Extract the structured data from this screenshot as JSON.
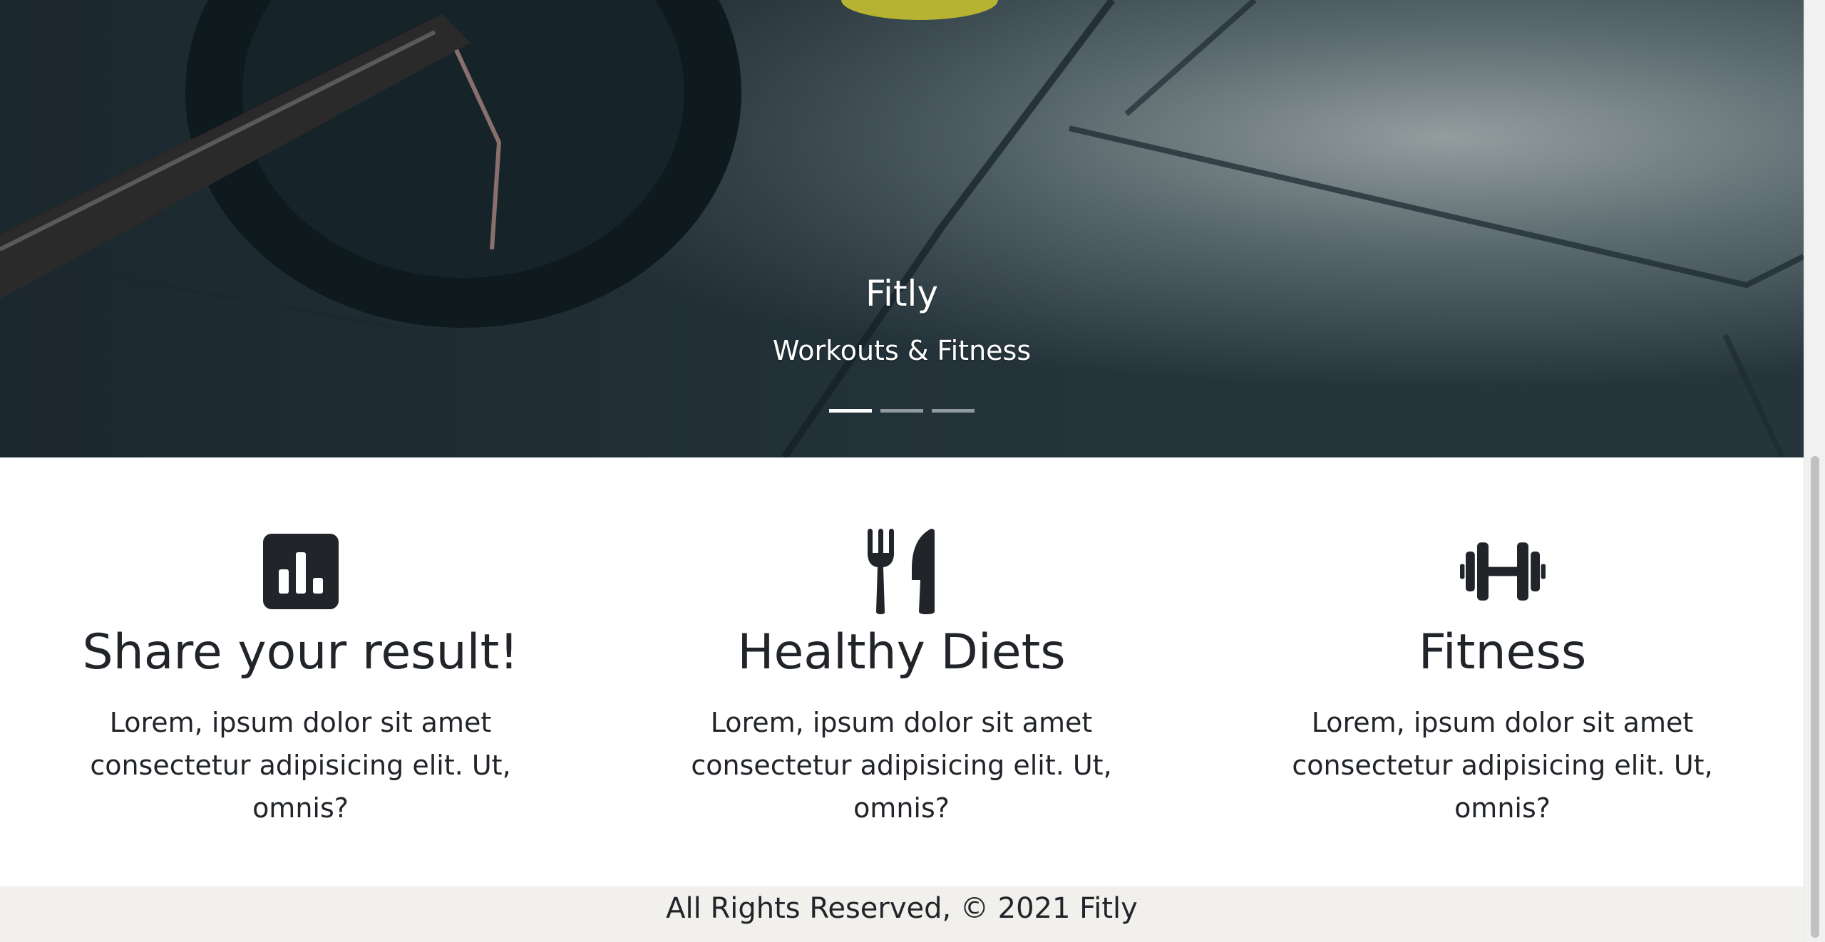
{
  "hero": {
    "title": "Fitly",
    "subtitle": "Workouts & Fitness",
    "indicators": [
      {
        "active": true
      },
      {
        "active": false
      },
      {
        "active": false
      }
    ]
  },
  "features": [
    {
      "icon": "bar-chart-icon",
      "title": "Share your result!",
      "text": "Lorem, ipsum dolor sit amet consectetur adipisicing elit. Ut, omnis?"
    },
    {
      "icon": "utensils-icon",
      "title": "Healthy Diets",
      "text": "Lorem, ipsum dolor sit amet consectetur adipisicing elit. Ut, omnis?"
    },
    {
      "icon": "dumbbell-icon",
      "title": "Fitness",
      "text": "Lorem, ipsum dolor sit amet consectetur adipisicing elit. Ut, omnis?"
    }
  ],
  "footer": {
    "text": "All Rights Reserved, © 2021 Fitly"
  },
  "colors": {
    "icon": "#212529",
    "footer_bg": "#f2f0ec",
    "hero_text": "#ffffff"
  }
}
